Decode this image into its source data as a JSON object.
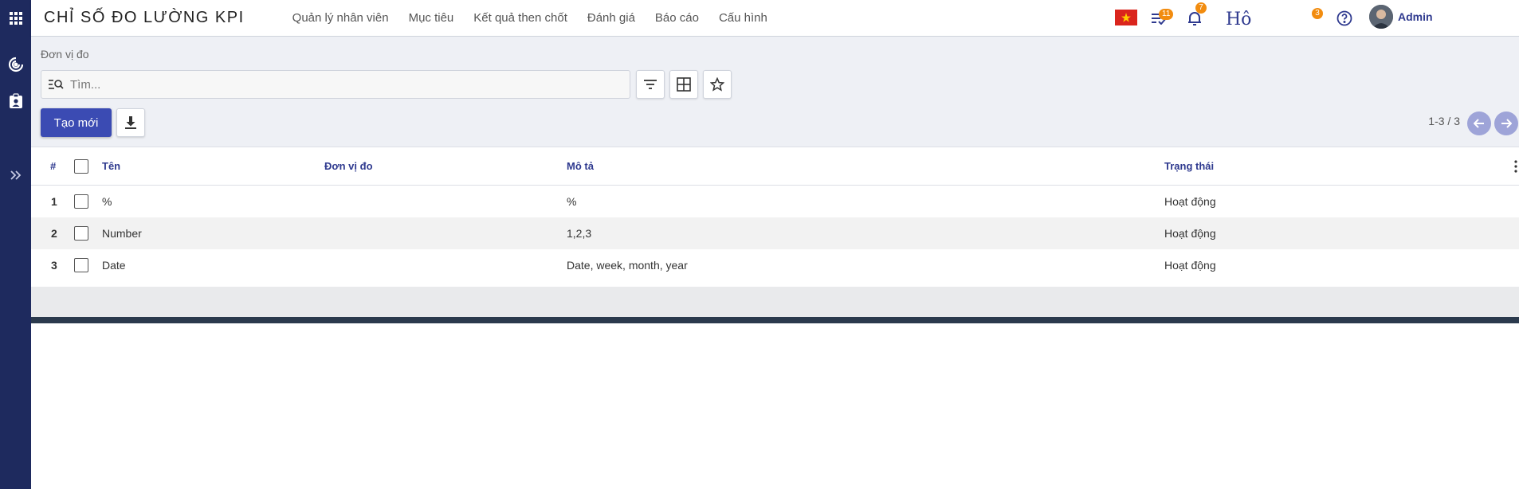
{
  "app": {
    "title": "CHỈ SỐ ĐO LƯỜNG KPI"
  },
  "nav": {
    "menu": [
      {
        "label": "Quản lý nhân viên"
      },
      {
        "label": "Mục tiêu"
      },
      {
        "label": "Kết quả then chốt"
      },
      {
        "label": "Đánh giá"
      },
      {
        "label": "Báo cáo"
      },
      {
        "label": "Cấu hình"
      }
    ]
  },
  "topbar_right": {
    "activities_badge": "11",
    "notifications_badge": "7",
    "signature_text": "Hô",
    "chat_badge": "3",
    "user_name": "Admin",
    "flag_colors": {
      "red": "#da251d",
      "star": "#ffcd00"
    }
  },
  "page": {
    "breadcrumb": "Đơn vị đo",
    "search": {
      "placeholder": "Tìm...",
      "value": ""
    },
    "create_label": "Tạo mới",
    "pager_text": "1-3 / 3"
  },
  "table": {
    "headers": {
      "num": "#",
      "name": "Tên",
      "unit": "Đơn vị đo",
      "description": "Mô tả",
      "status": "Trạng thái"
    },
    "rows": [
      {
        "num": "1",
        "name": "%",
        "unit": "",
        "description": "%",
        "status": "Hoạt động"
      },
      {
        "num": "2",
        "name": "Number",
        "unit": "",
        "description": "1,2,3",
        "status": "Hoạt động"
      },
      {
        "num": "3",
        "name": "Date",
        "unit": "",
        "description": "Date, week, month, year",
        "status": "Hoạt động"
      }
    ]
  },
  "colors": {
    "rail": "#1e2a5e",
    "primary_button": "#3b4bb3",
    "header_text": "#2f3a8f",
    "badge": "#f28c0f",
    "pager_button": "#9ea4d8"
  },
  "icons": {
    "apps": "apps-grid-icon",
    "target": "target-icon",
    "clipboard": "clipboard-user-icon",
    "expand": "double-chevron-right-icon",
    "activities": "activities-list-check-icon",
    "bell": "bell-icon",
    "help": "help-circle-icon",
    "filter": "filter-icon",
    "group_by": "table-grid-icon",
    "favorites": "star-icon",
    "download": "download-icon"
  }
}
